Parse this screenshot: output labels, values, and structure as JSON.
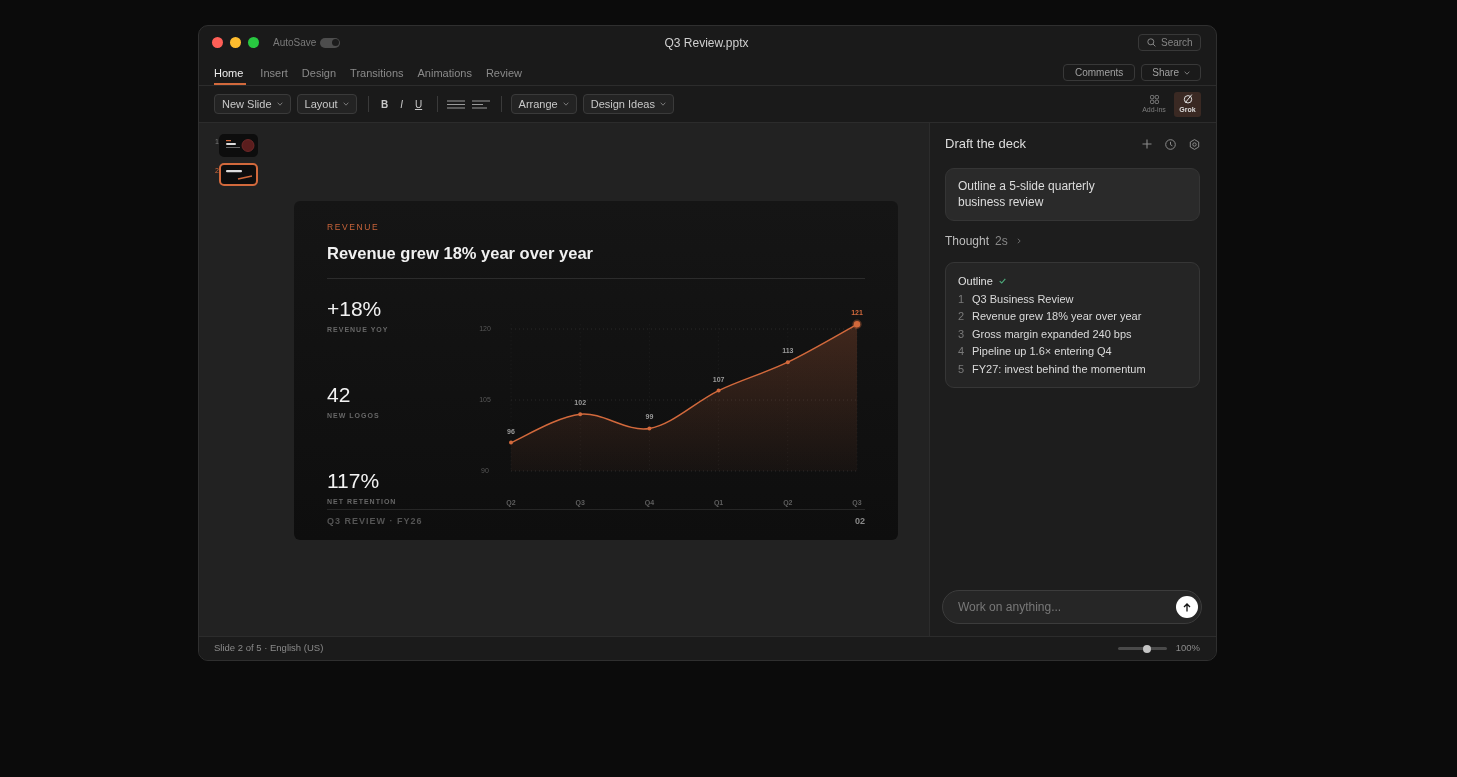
{
  "window": {
    "title": "Q3 Review.pptx"
  },
  "title_bar": {
    "autosave": {
      "label": "AutoSave",
      "on": true
    },
    "search": {
      "label": "Search"
    }
  },
  "ribbon": {
    "tabs": [
      {
        "label": "Home",
        "selected": true
      },
      {
        "label": "Insert",
        "selected": false
      },
      {
        "label": "Design",
        "selected": false
      },
      {
        "label": "Transitions",
        "selected": false
      },
      {
        "label": "Animations",
        "selected": false
      },
      {
        "label": "Review",
        "selected": false
      }
    ],
    "actions": [
      {
        "label": "Comments",
        "kind": "button"
      },
      {
        "label": "Share",
        "kind": "dropdown"
      }
    ]
  },
  "toolbar": {
    "items": [
      {
        "kind": "dropdown",
        "label": "New Slide"
      },
      {
        "kind": "dropdown",
        "label": "Layout"
      },
      {
        "kind": "separator"
      },
      {
        "kind": "bold",
        "label": "B"
      },
      {
        "kind": "italic",
        "label": "I"
      },
      {
        "kind": "underline",
        "label": "U"
      },
      {
        "kind": "separator"
      },
      {
        "kind": "justify"
      },
      {
        "kind": "alignleft"
      },
      {
        "kind": "separator"
      },
      {
        "kind": "dropdown",
        "label": "Arrange"
      },
      {
        "kind": "dropdown",
        "label": "Design Ideas"
      }
    ],
    "tools": [
      {
        "kind": "addins",
        "label": "Add-ins",
        "selected": false
      },
      {
        "kind": "grok",
        "label": "Grok",
        "selected": true
      }
    ]
  },
  "slides_panel": {
    "thumbnails": [
      {
        "number": "1",
        "kind": "title",
        "selected": false
      },
      {
        "number": "2",
        "kind": "chart",
        "selected": true
      }
    ]
  },
  "slide": {
    "eyebrow": "REVENUE",
    "title": "Revenue grew 18% year over year",
    "stats": [
      {
        "value": "+18%",
        "label": "REVENUE YOY"
      },
      {
        "value": "42",
        "label": "NEW LOGOS"
      },
      {
        "value": "117%",
        "label": "NET RETENTION"
      }
    ],
    "chart_data": {
      "type": "area",
      "categories": [
        "Q2",
        "Q3",
        "Q4",
        "Q1",
        "Q2",
        "Q3"
      ],
      "series": [
        {
          "color": "#d2693c",
          "values": [
            96,
            102,
            99,
            107,
            113,
            121
          ]
        }
      ],
      "ylim": [
        90,
        121
      ],
      "yticks": [
        90,
        105,
        120
      ],
      "grid": true,
      "data_labels": true
    },
    "footer": {
      "left": "Q3 REVIEW · FY26",
      "page": "02"
    }
  },
  "assistant": {
    "title": "Draft the deck",
    "prompt": "Outline a 5-slide quarterly business review",
    "thought": {
      "label": "Thought",
      "duration": "2s",
      "expanded": false
    },
    "outline": {
      "title": "Outline",
      "complete": true,
      "items": [
        {
          "number": "1",
          "text": "Q3 Business Review"
        },
        {
          "number": "2",
          "text": "Revenue grew 18% year over year"
        },
        {
          "number": "3",
          "text": "Gross margin expanded 240 bps"
        },
        {
          "number": "4",
          "text": "Pipeline up 1.6× entering Q4"
        },
        {
          "number": "5",
          "text": "FY27: invest behind the momentum"
        }
      ]
    },
    "input": {
      "placeholder": "Work on anything..."
    }
  },
  "status_bar": {
    "text": "Slide 2 of 5 · English (US)",
    "zoom": {
      "level": 0.6,
      "reading": "100%"
    }
  }
}
